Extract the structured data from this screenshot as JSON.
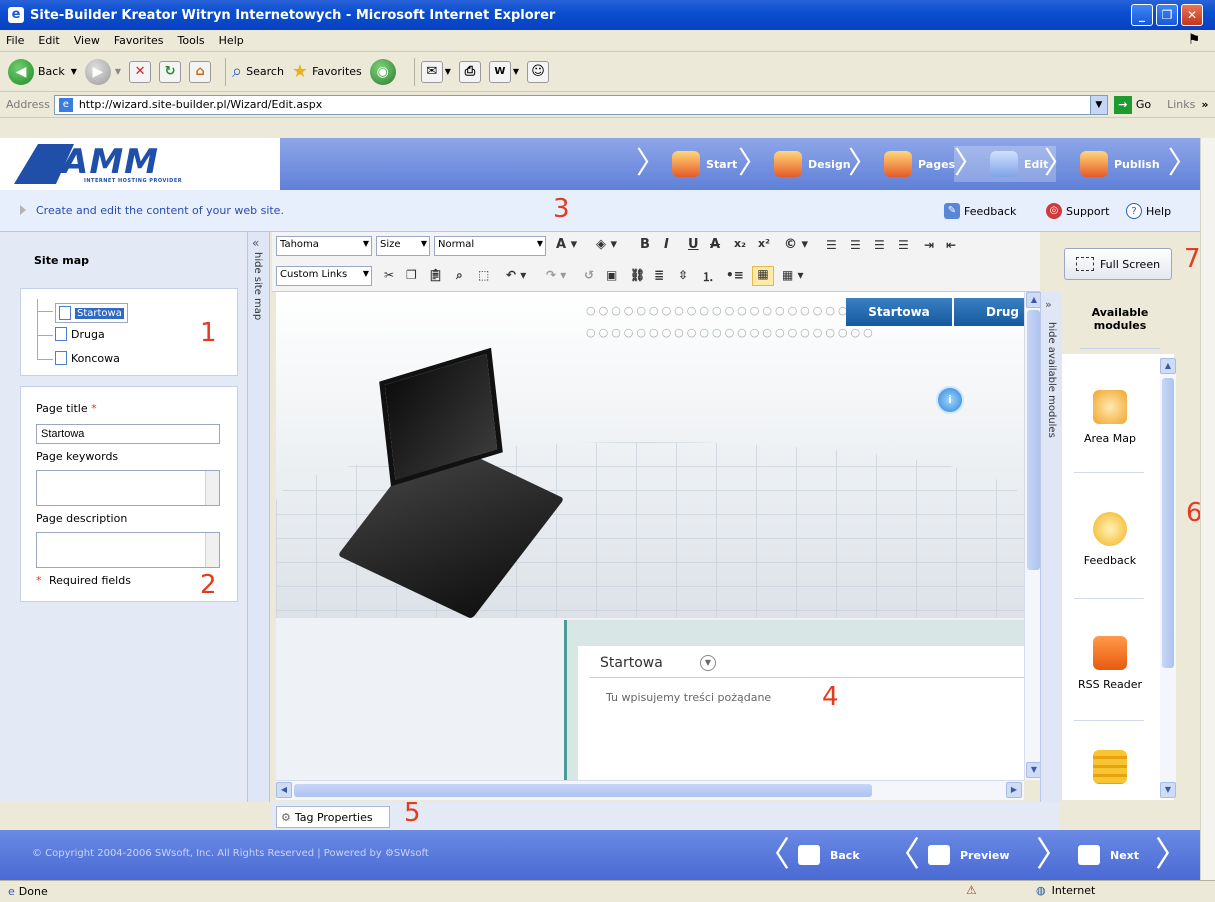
{
  "window": {
    "title": "Site-Builder Kreator Witryn Internetowych - Microsoft Internet Explorer",
    "minimize": "_",
    "maximize": "❐",
    "close": "✕"
  },
  "menu": [
    "File",
    "Edit",
    "View",
    "Favorites",
    "Tools",
    "Help"
  ],
  "toolbar": {
    "back": "Back",
    "search": "Search",
    "favorites": "Favorites"
  },
  "address": {
    "label": "Address",
    "url": "http://wizard.site-builder.pl/Wizard/Edit.aspx",
    "go": "Go",
    "links": "Links"
  },
  "header": {
    "logo": "AMM",
    "logo_sub": "INTERNET HOSTING PROVIDER",
    "steps": [
      "Start",
      "Design",
      "Pages",
      "Edit",
      "Publish"
    ],
    "active_step": "Edit"
  },
  "infobar": {
    "text": "Create and edit the content of your web site.",
    "feedback": "Feedback",
    "support": "Support",
    "help": "Help"
  },
  "annotations": [
    "1",
    "2",
    "3",
    "4",
    "5",
    "6",
    "7"
  ],
  "sidebar": {
    "title": "Site map",
    "hide_label": "hide site map",
    "pages": [
      "Startowa",
      "Druga",
      "Koncowa"
    ],
    "selected_page": "Startowa",
    "page_title_label": "Page title",
    "page_title_value": "Startowa",
    "keywords_label": "Page keywords",
    "description_label": "Page description",
    "required_note": "Required fields",
    "required_mark": "*"
  },
  "editor": {
    "font": "Tahoma",
    "size": "Size",
    "format": "Normal",
    "custom_links": "Custom Links",
    "nav_tabs": [
      "Startowa",
      "Drug"
    ],
    "content_title": "Startowa",
    "content_body": "Tu wpisujemy treści pożądane",
    "tag_properties": "Tag Properties"
  },
  "modules": {
    "full_screen": "Full Screen",
    "hide_label": "hide available modules",
    "heading": "Available modules",
    "items": [
      {
        "label": "Area Map",
        "icon": "area-map-icon",
        "color": "#f0a52c"
      },
      {
        "label": "Feedback",
        "icon": "feedback-icon",
        "color": "#f2b21a"
      },
      {
        "label": "RSS Reader",
        "icon": "rss-icon",
        "color": "#f06a14"
      },
      {
        "label": "",
        "icon": "scroll-icon",
        "color": "#f2b21a"
      }
    ]
  },
  "footer": {
    "copyright": "© Copyright 2004-2006 SWsoft, Inc. All Rights Reserved | Powered by ⚙SWsoft",
    "back": "Back",
    "preview": "Preview",
    "next": "Next"
  },
  "status": {
    "left": "Done",
    "zone": "Internet"
  },
  "colors": {
    "title_bar": "#0a4fd0",
    "header": "#5f80d8",
    "annotation": "#e63a1e",
    "selection": "#316ac5"
  }
}
